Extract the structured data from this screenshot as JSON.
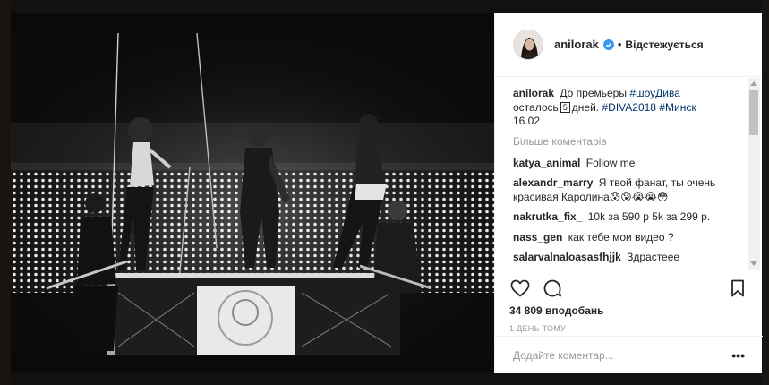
{
  "post": {
    "username": "anilorak",
    "follow_label": "Відстежується",
    "caption": {
      "username": "anilorak",
      "text_1": "До премьеры",
      "tag_1": "#шоуДива",
      "text_2": "осталось",
      "boxed_number": "5",
      "text_3": "дней.",
      "tag_2": "#DIVA2018",
      "tag_3": "#Минск",
      "date": "16.02"
    },
    "more_comments_label": "Більше коментарів",
    "comments": [
      {
        "user": "katya_animal",
        "text": "Follow me"
      },
      {
        "user": "alexandr_marry",
        "text": "Я твой фанат, ты очень красивая Каролина😰😰😭😭😳"
      },
      {
        "user": "nakrutka_fix_",
        "text": "10k за 590 р 5k за 299 р."
      },
      {
        "user": "nass_gen",
        "text": "как тебе мои видео ?"
      },
      {
        "user": "salarvalnaloasasfhjjk",
        "text": "Здрастеее"
      }
    ],
    "likes": "34 809 вподобань",
    "timestamp": "1 ДЕНЬ ТОМУ",
    "comment_placeholder": "Додайте коментар..."
  },
  "icons": {
    "like": "heart-icon",
    "comment": "comment-bubble-icon",
    "save": "bookmark-icon",
    "verified": "verified-badge-icon",
    "options": "more-options-icon"
  },
  "colors": {
    "link": "#003569",
    "verified": "#3897f0",
    "secondary_text": "#999999",
    "primary_text": "#262626"
  }
}
